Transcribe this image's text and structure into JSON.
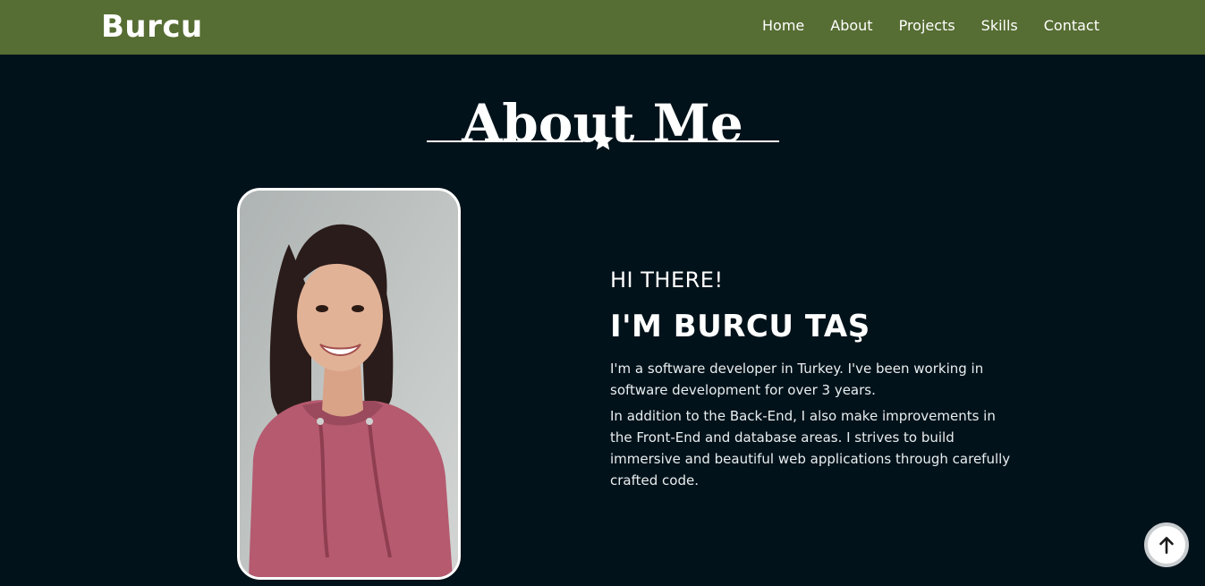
{
  "brand": "Burcu",
  "nav": {
    "items": [
      {
        "label": "Home"
      },
      {
        "label": "About"
      },
      {
        "label": "Projects"
      },
      {
        "label": "Skills"
      },
      {
        "label": "Contact"
      }
    ]
  },
  "about": {
    "title": "About Me",
    "greeting": "HI THERE!",
    "name": "I'M BURCU TAŞ",
    "paragraphs": [
      "I'm a software developer in Turkey. I've been working in software development for over 3 years.",
      "In addition to the Back-End, I also make improvements in the Front-End and database areas. I strives to build immersive and beautiful web applications through carefully crafted code."
    ],
    "divider_icon": "star-icon"
  },
  "scroll_top": {
    "icon": "arrow-up-icon"
  },
  "colors": {
    "navbar": "#566d33",
    "background": "#02121a",
    "text": "#ffffff"
  }
}
